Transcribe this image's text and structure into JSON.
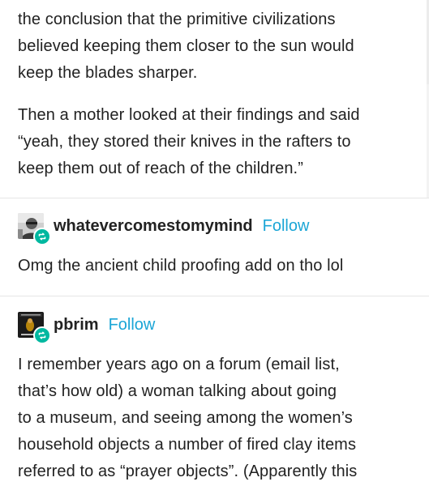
{
  "post_top": {
    "paragraph_1": "the conclusion that the primitive civilizations\nbelieved keeping them closer to the sun would\nkeep the blades sharper.",
    "paragraph_2": "Then a mother looked at their findings and said\n“yeah, they stored their knives in the rafters to\nkeep them out of reach of the children.”"
  },
  "reblog_1": {
    "username": "whatevercomestomymind",
    "follow_label": "Follow",
    "avatar_icon": "avatar-bw-photo-icon",
    "badge_icon": "reblog-icon",
    "badge_color": "#00b8a0",
    "body": "Omg the ancient child proofing add on tho lol"
  },
  "reblog_2": {
    "username": "pbrim",
    "follow_label": "Follow",
    "avatar_icon": "avatar-book-cover-icon",
    "badge_icon": "reblog-icon",
    "badge_color": "#00b8a0",
    "body": "I remember years ago on a forum (email list,\nthat’s how old) a woman talking about going\nto a museum, and seeing among the women’s\nhousehold objects a number of fired clay items\nreferred to as “prayer objects”.  (Apparently this"
  },
  "colors": {
    "text": "#222222",
    "follow_link": "#1aa5d6",
    "divider": "#e6e6e6"
  }
}
